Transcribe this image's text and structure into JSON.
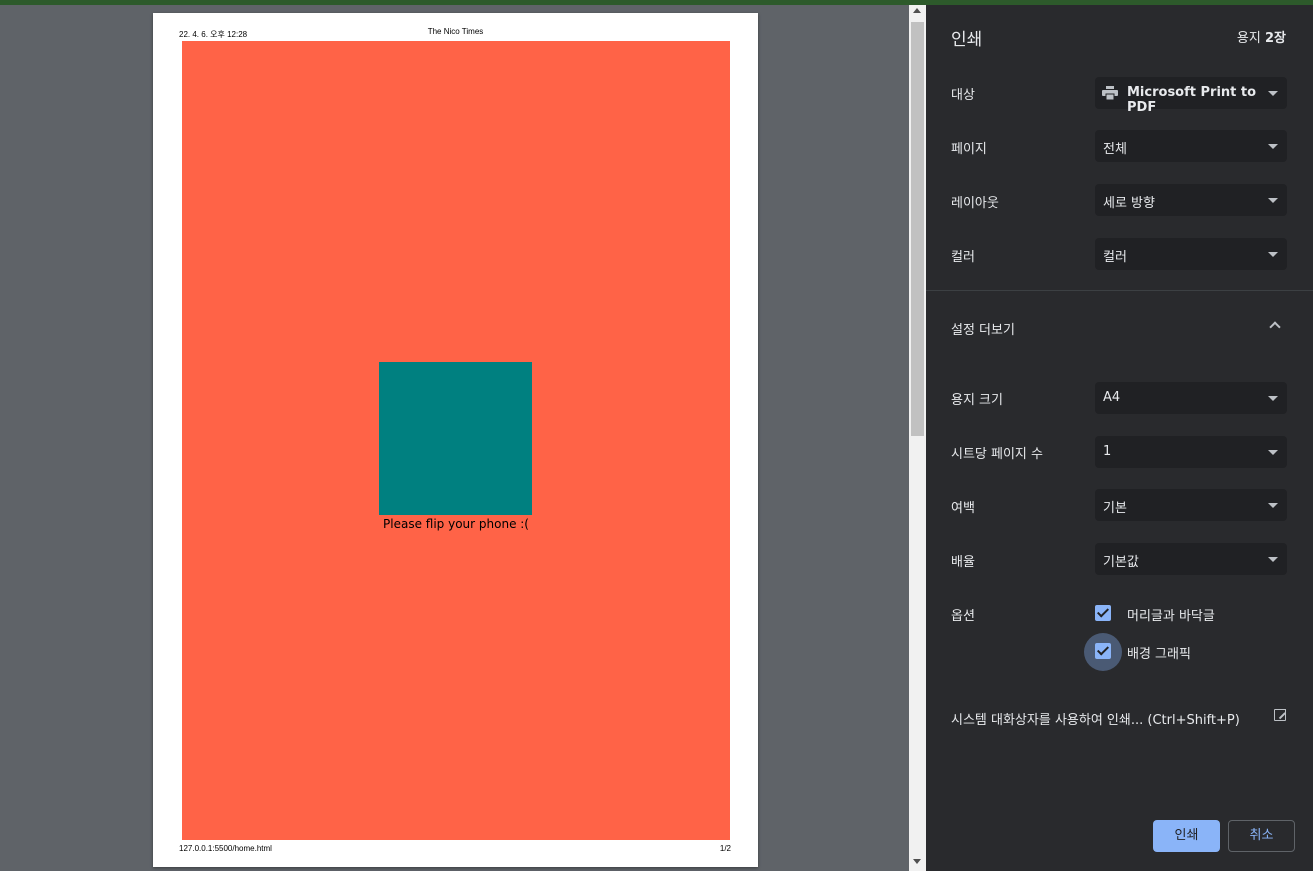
{
  "preview": {
    "header_date": "22. 4. 6. 오후 12:28",
    "header_title": "The Nico Times",
    "body_message": "Please flip your phone :(",
    "footer_url": "127.0.0.1:5500/home.html",
    "footer_page": "1/2",
    "colors": {
      "background": "#ff6347",
      "box": "#008080"
    }
  },
  "sidebar": {
    "title": "인쇄",
    "sheets_prefix": "용지 ",
    "sheets_count": "2장",
    "destination": {
      "label": "대상",
      "value": "Microsoft Print to PDF",
      "icon": "printer-icon"
    },
    "pages": {
      "label": "페이지",
      "value": "전체"
    },
    "layout": {
      "label": "레이아웃",
      "value": "세로 방향"
    },
    "color": {
      "label": "컬러",
      "value": "컬러"
    },
    "more_settings": "설정 더보기",
    "paper_size": {
      "label": "용지 크기",
      "value": "A4"
    },
    "pages_per_sheet": {
      "label": "시트당 페이지 수",
      "value": "1"
    },
    "margins": {
      "label": "여백",
      "value": "기본"
    },
    "scale": {
      "label": "배율",
      "value": "기본값"
    },
    "options": {
      "label": "옵션",
      "headers_footers": {
        "label": "머리글과 바닥글",
        "checked": true
      },
      "background_graphics": {
        "label": "배경 그래픽",
        "checked": true
      }
    },
    "system_dialog": "시스템 대화상자를 사용하여 인쇄... (Ctrl+Shift+P)",
    "print_button": "인쇄",
    "cancel_button": "취소"
  }
}
